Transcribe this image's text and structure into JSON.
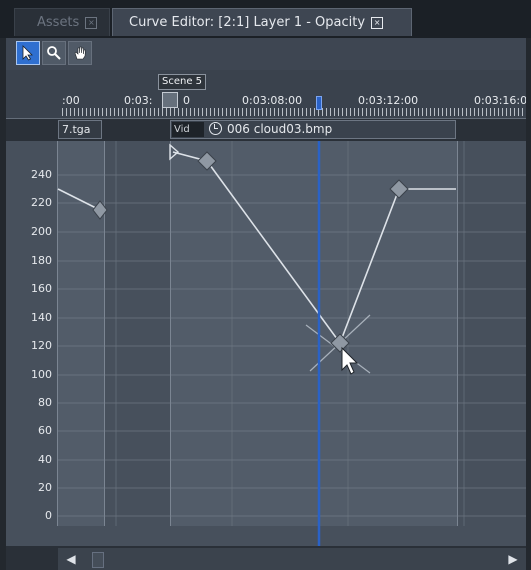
{
  "tabs": [
    {
      "label": "Assets"
    },
    {
      "label": "Curve Editor: [2:1] Layer 1 - Opacity"
    }
  ],
  "toolbar": {
    "tools": [
      {
        "icon": "pointer-icon",
        "active": true
      },
      {
        "icon": "magnifier-icon",
        "active": false
      },
      {
        "icon": "hand-icon",
        "active": false
      }
    ]
  },
  "ruler": {
    "labels": [
      ":00",
      "0:03:",
      "0",
      "0:03:08:00",
      "0:03:12:00",
      "0:03:16:0"
    ]
  },
  "scene_marker": "Scene 5",
  "clips": {
    "left_label": "7.tga",
    "middle_tag": "Vid",
    "middle_label": "006 cloud03.bmp"
  },
  "y_axis": [
    "240",
    "220",
    "200",
    "180",
    "160",
    "140",
    "120",
    "100",
    "80",
    "60",
    "40",
    "20",
    "0"
  ],
  "colors": {
    "accent": "#2a62c7",
    "curve": "#dde2e8",
    "keyframe": "#8f98a3"
  }
}
